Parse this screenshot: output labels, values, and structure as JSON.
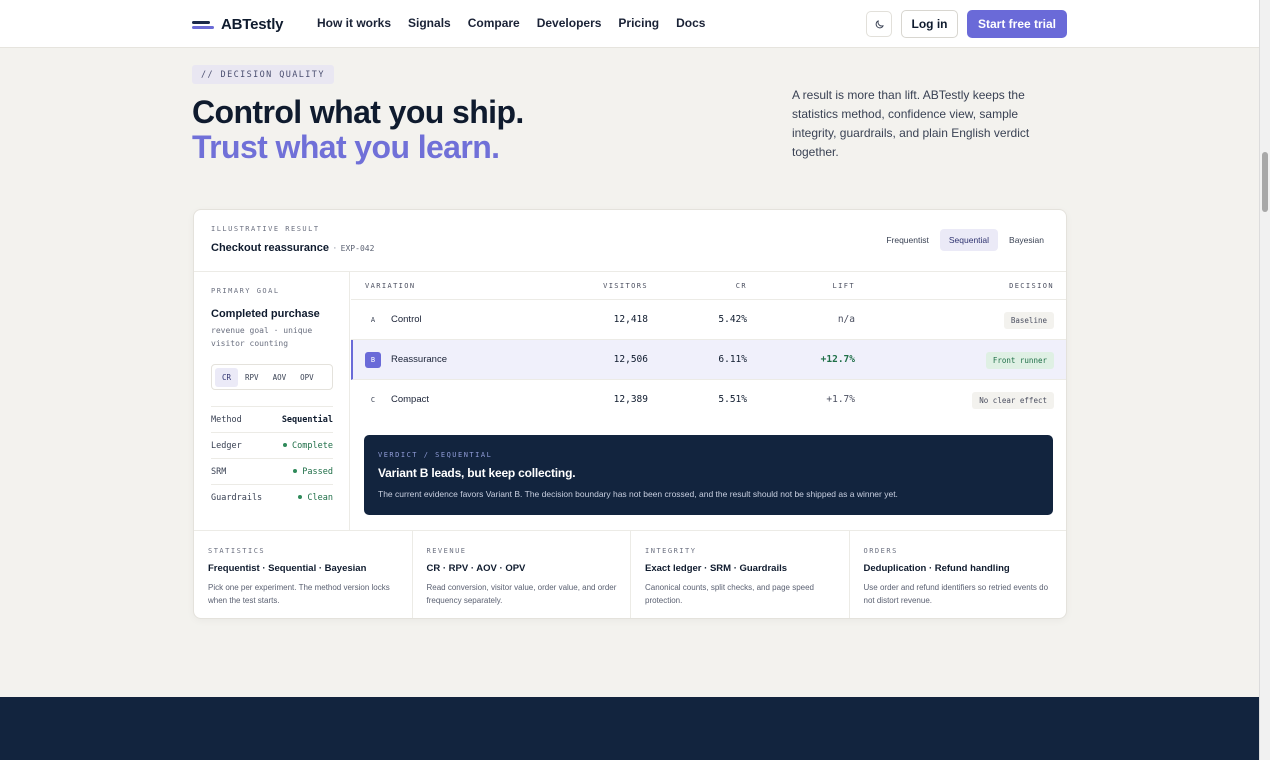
{
  "brand": {
    "name": "ABTestly"
  },
  "nav": [
    "How it works",
    "Signals",
    "Compare",
    "Developers",
    "Pricing",
    "Docs"
  ],
  "header": {
    "login": "Log in",
    "cta": "Start free trial"
  },
  "hero": {
    "eyebrow": "// DECISION QUALITY",
    "title_line1": "Control what you ship.",
    "title_line2": "Trust what you learn.",
    "description": "A result is more than lift. ABTestly keeps the statistics method, confidence view, sample integrity, guardrails, and plain English verdict together."
  },
  "card": {
    "eyebrow": "ILLUSTRATIVE RESULT",
    "title": "Checkout reassurance",
    "separator": "·",
    "code": "EXP-042",
    "method_tabs": [
      "Frequentist",
      "Sequential",
      "Bayesian"
    ],
    "active_method": "Sequential",
    "goal": {
      "label": "PRIMARY GOAL",
      "title": "Completed purchase",
      "subtitle": "revenue goal · unique visitor counting",
      "metrics": [
        "CR",
        "RPV",
        "AOV",
        "OPV"
      ]
    },
    "details": [
      {
        "key": "Method",
        "value": "Sequential"
      },
      {
        "key": "Ledger",
        "value": "Complete"
      },
      {
        "key": "SRM",
        "value": "Passed"
      },
      {
        "key": "Guardrails",
        "value": "Clean"
      }
    ],
    "table": {
      "headers": [
        "VARIATION",
        "VISITORS",
        "CR",
        "LIFT",
        "DECISION"
      ],
      "rows": [
        {
          "badge": "A",
          "name": "Control",
          "visitors": "12,418",
          "cr": "5.42%",
          "lift": "n/a",
          "decision": "Baseline"
        },
        {
          "badge": "B",
          "name": "Reassurance",
          "visitors": "12,506",
          "cr": "6.11%",
          "lift": "+12.7%",
          "decision": "Front runner"
        },
        {
          "badge": "C",
          "name": "Compact",
          "visitors": "12,389",
          "cr": "5.51%",
          "lift": "+1.7%",
          "decision": "No clear effect"
        }
      ]
    },
    "verdict": {
      "label": "VERDICT / SEQUENTIAL",
      "title": "Variant B leads, but keep collecting.",
      "description": "The current evidence favors Variant B. The decision boundary has not been crossed, and the result should not be shipped as a winner yet."
    },
    "features": [
      {
        "label": "STATISTICS",
        "title": "Frequentist · Sequential · Bayesian",
        "description": "Pick one per experiment. The method version locks when the test starts."
      },
      {
        "label": "REVENUE",
        "title": "CR · RPV · AOV · OPV",
        "description": "Read conversion, visitor value, order value, and order frequency separately."
      },
      {
        "label": "INTEGRITY",
        "title": "Exact ledger · SRM · Guardrails",
        "description": "Canonical counts, split checks, and page speed protection."
      },
      {
        "label": "ORDERS",
        "title": "Deduplication · Refund handling",
        "description": "Use order and refund identifiers so retried events do not distort revenue."
      }
    ]
  },
  "colors": {
    "accent": "#6a6ad8",
    "navy": "#12243e",
    "positive": "#1f6f48"
  }
}
